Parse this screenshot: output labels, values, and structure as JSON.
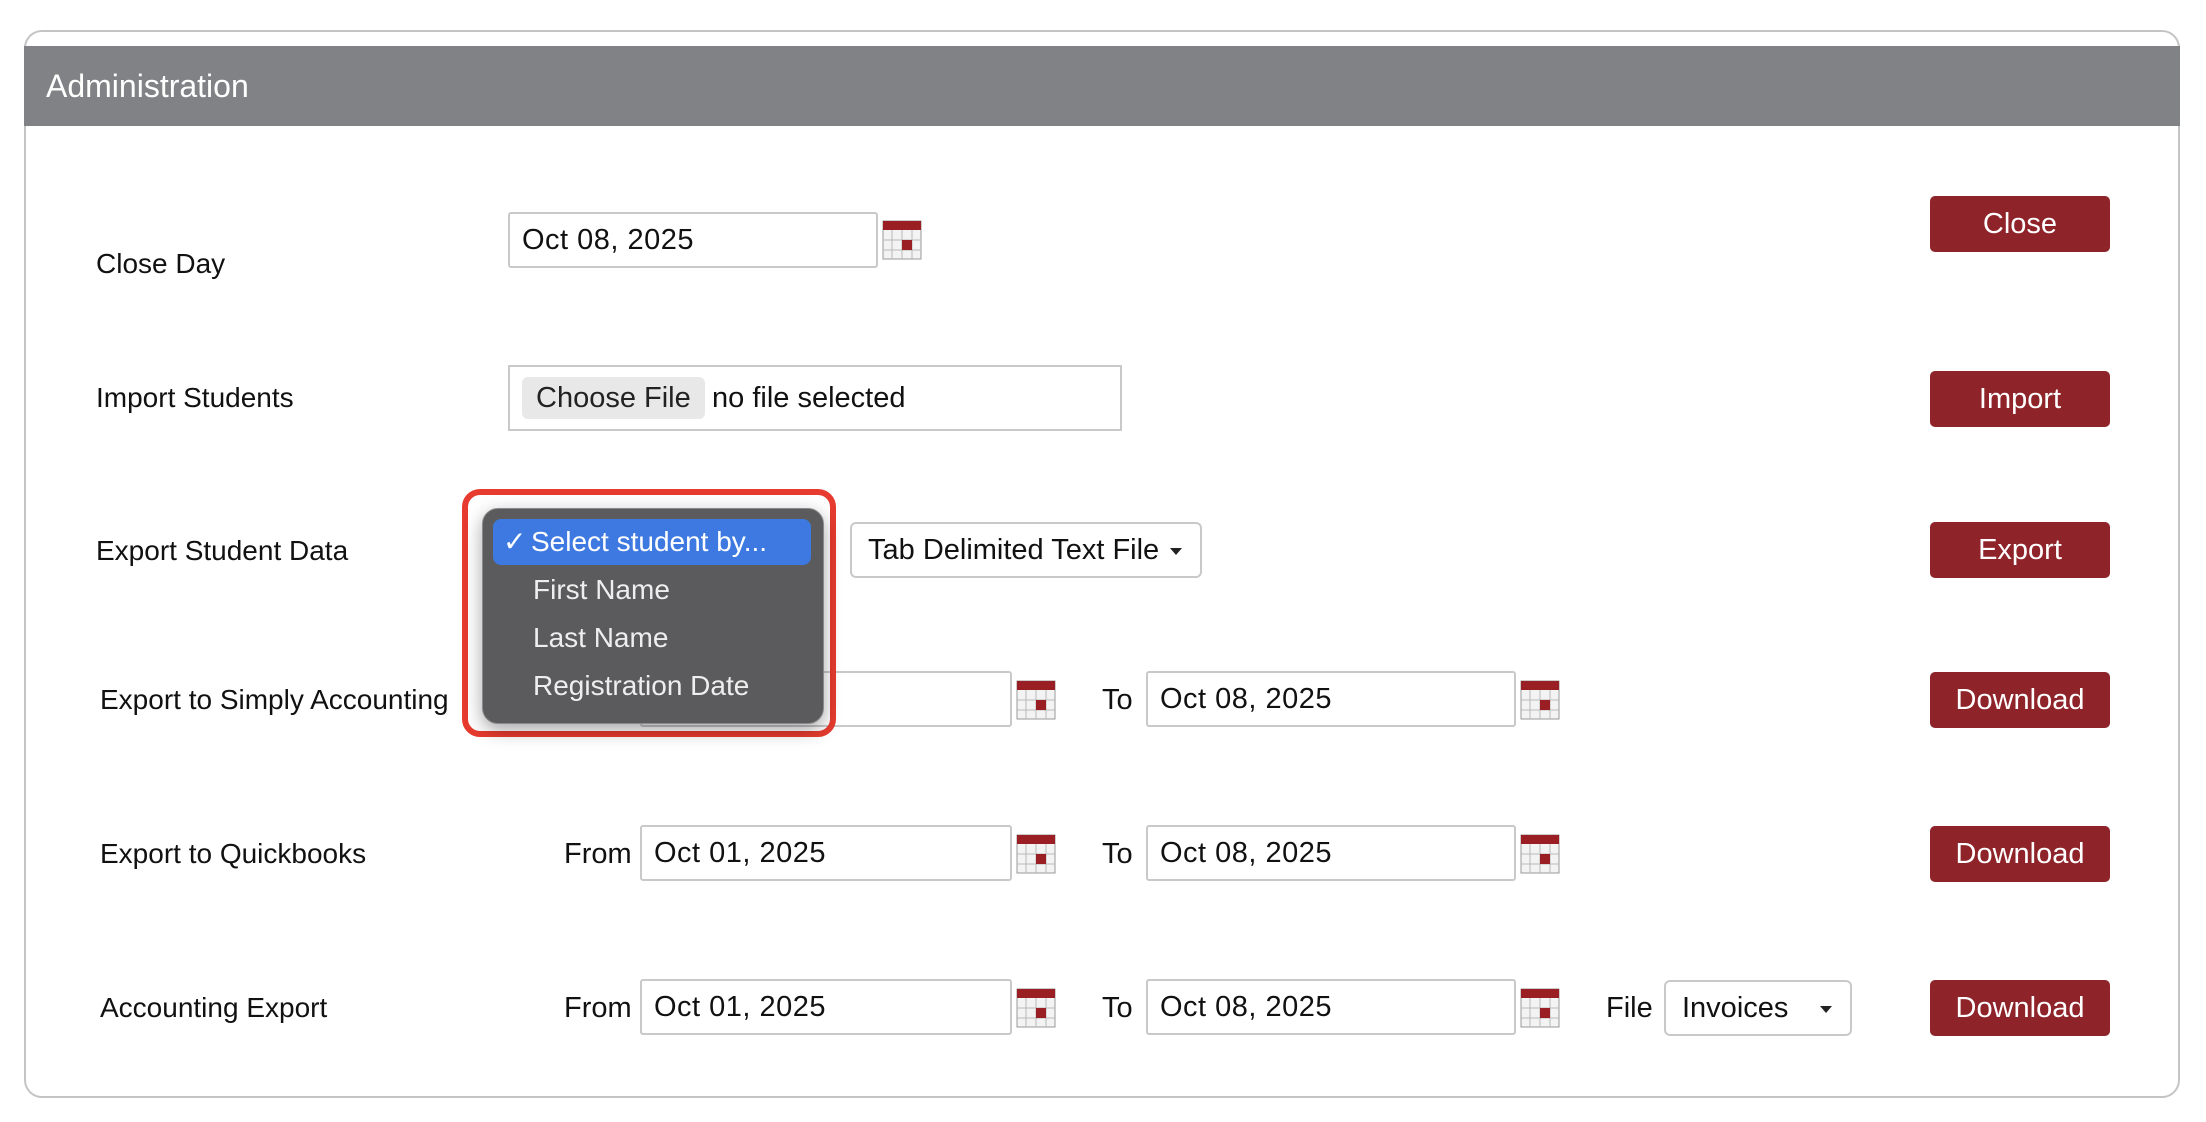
{
  "panel": {
    "title": "Administration"
  },
  "rows": {
    "close_day": {
      "label": "Close  Day",
      "date": "Oct 08, 2025",
      "button": "Close"
    },
    "import_students": {
      "label": "Import Students",
      "choose_file": "Choose File",
      "file_status": "no file selected",
      "button": "Import"
    },
    "export_student_data": {
      "label": "Export Student Data",
      "select_options": [
        "Select student by...",
        "First Name",
        "Last Name",
        "Registration Date"
      ],
      "selected_index": 0,
      "format": "Tab Delimited Text File",
      "button": "Export"
    },
    "simply_accounting": {
      "label": "Export to Simply Accounting",
      "to_label": "To",
      "to_date": "Oct 08, 2025",
      "button": "Download"
    },
    "quickbooks": {
      "label": "Export to Quickbooks",
      "from_label": "From",
      "from_date": "Oct 01, 2025",
      "to_label": "To",
      "to_date": "Oct 08, 2025",
      "button": "Download"
    },
    "accounting_export": {
      "label": "Accounting Export",
      "from_label": "From",
      "from_date": "Oct 01, 2025",
      "to_label": "To",
      "to_date": "Oct 08, 2025",
      "file_label": "File",
      "file_type": "Invoices",
      "button": "Download"
    }
  },
  "colors": {
    "header": "#818285",
    "button": "#8e2329",
    "highlight": "#e63b2e",
    "dropdown_selected": "#3d79e0"
  }
}
